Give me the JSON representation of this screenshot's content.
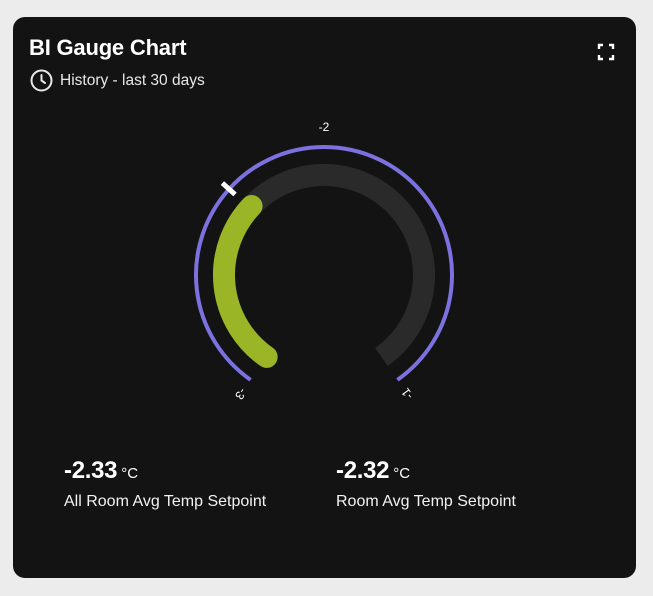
{
  "card": {
    "title": "BI Gauge Chart",
    "subtitle": "History - last 30 days",
    "clock_icon": "clock-icon",
    "expand_icon": "fullscreen-icon"
  },
  "gauge": {
    "min_label": "-3",
    "mid_label": "-2",
    "max_label": "-1",
    "min": -3,
    "max": -1,
    "value": -2.32,
    "marker_value": -2.33,
    "value_color": "#9ab526",
    "track_color": "#2a2a2a",
    "range_color": "#7b72e0",
    "marker_color": "#ffffff"
  },
  "metrics": [
    {
      "value": "-2.33",
      "unit": "°C",
      "label": "All Room Avg Temp Setpoint"
    },
    {
      "value": "-2.32",
      "unit": "°C",
      "label": "Room Avg Temp Setpoint"
    }
  ]
}
